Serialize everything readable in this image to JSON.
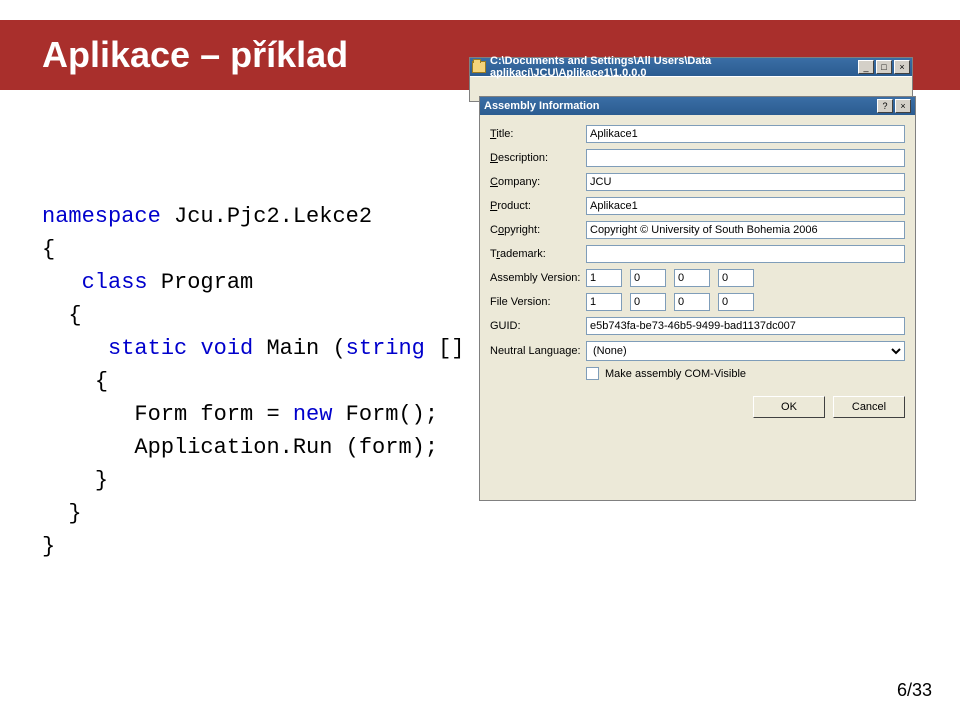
{
  "header": {
    "title": "Aplikace – příklad"
  },
  "code": {
    "kw_namespace": "namespace",
    "ns_value": "Jcu.Pjc2.Lekce2",
    "brace_open": "{",
    "kw_class": "class",
    "class_name": "Program",
    "kw_static": "static",
    "kw_void": "void",
    "main_sig_a": "Main (",
    "kw_string": "string",
    "main_sig_b": " [] args)",
    "line_form_a": "Form form = ",
    "kw_new": "new",
    "line_form_b": " Form();",
    "line_app": "Application.Run (form);",
    "brace_close": "}"
  },
  "explorer": {
    "title": "C:\\Documents and Settings\\All Users\\Data aplikací\\JCU\\Aplikace1\\1.0.0.0",
    "btn_min": "_",
    "btn_max": "□",
    "btn_close": "×"
  },
  "dialog": {
    "title": "Assembly Information",
    "btn_help": "?",
    "btn_close": "×",
    "labels": {
      "title": "Title:",
      "description": "Description:",
      "company": "Company:",
      "product": "Product:",
      "copyright": "Copyright:",
      "trademark": "Trademark:",
      "assembly_version": "Assembly Version:",
      "file_version": "File Version:",
      "guid": "GUID:",
      "neutral_language": "Neutral Language:",
      "com_visible": "Make assembly COM-Visible"
    },
    "values": {
      "title": "Aplikace1",
      "description": "",
      "company": "JCU",
      "product": "Aplikace1",
      "copyright": "Copyright © University of South Bohemia 2006",
      "trademark": "",
      "assembly_version": [
        "1",
        "0",
        "0",
        "0"
      ],
      "file_version": [
        "1",
        "0",
        "0",
        "0"
      ],
      "guid": "e5b743fa-be73-46b5-9499-bad1137dc007",
      "neutral_language": "(None)"
    },
    "buttons": {
      "ok": "OK",
      "cancel": "Cancel"
    }
  },
  "footer": {
    "page": "6/33"
  }
}
